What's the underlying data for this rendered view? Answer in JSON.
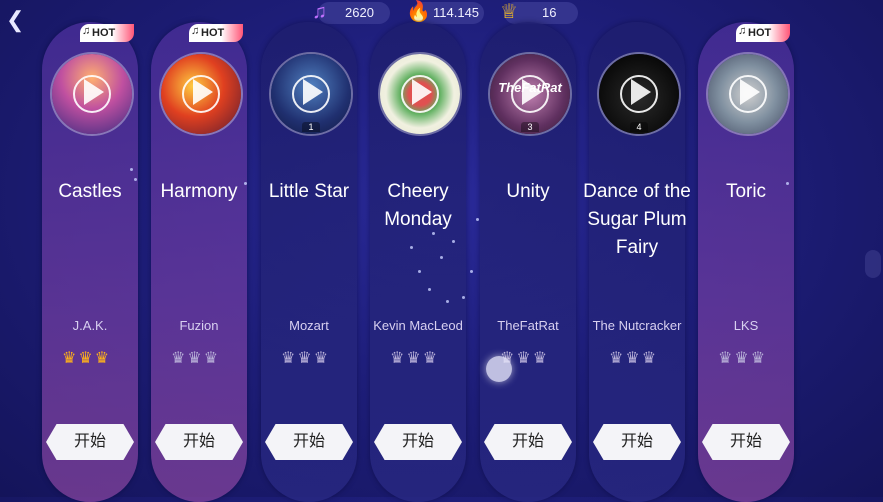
{
  "header": {
    "notes": "2620",
    "fire": "114.145",
    "crowns": "16",
    "notes_icon": "music-note-icon",
    "fire_icon": "flame-icon",
    "crown_icon": "crown-icon"
  },
  "start_label": "开始",
  "hot_label": "HOT",
  "songs": [
    {
      "title": "Castles",
      "artist": "J.A.K.",
      "hot": true,
      "crowns": 3,
      "number": ""
    },
    {
      "title": "Harmony",
      "artist": "Fuzion",
      "hot": true,
      "crowns": 0,
      "number": ""
    },
    {
      "title": "Little Star",
      "artist": "Mozart",
      "hot": false,
      "crowns": 0,
      "number": "1"
    },
    {
      "title": "Cheery Monday",
      "artist": "Kevin MacLeod",
      "hot": false,
      "crowns": 0,
      "number": ""
    },
    {
      "title": "Unity",
      "artist": "TheFatRat",
      "hot": false,
      "crowns": 0,
      "number": "3"
    },
    {
      "title": "Dance of the Sugar Plum Fairy",
      "artist": "The Nutcracker",
      "hot": false,
      "crowns": 0,
      "number": "4"
    },
    {
      "title": "Toric",
      "artist": "LKS",
      "hot": true,
      "crowns": 0,
      "number": ""
    }
  ],
  "cover_text": {
    "unity": "TheFatRat"
  },
  "colors": {
    "crown_on": "#ffb21a",
    "crown_off": "#b8b0d8",
    "hot_badge": "#ff5577"
  }
}
